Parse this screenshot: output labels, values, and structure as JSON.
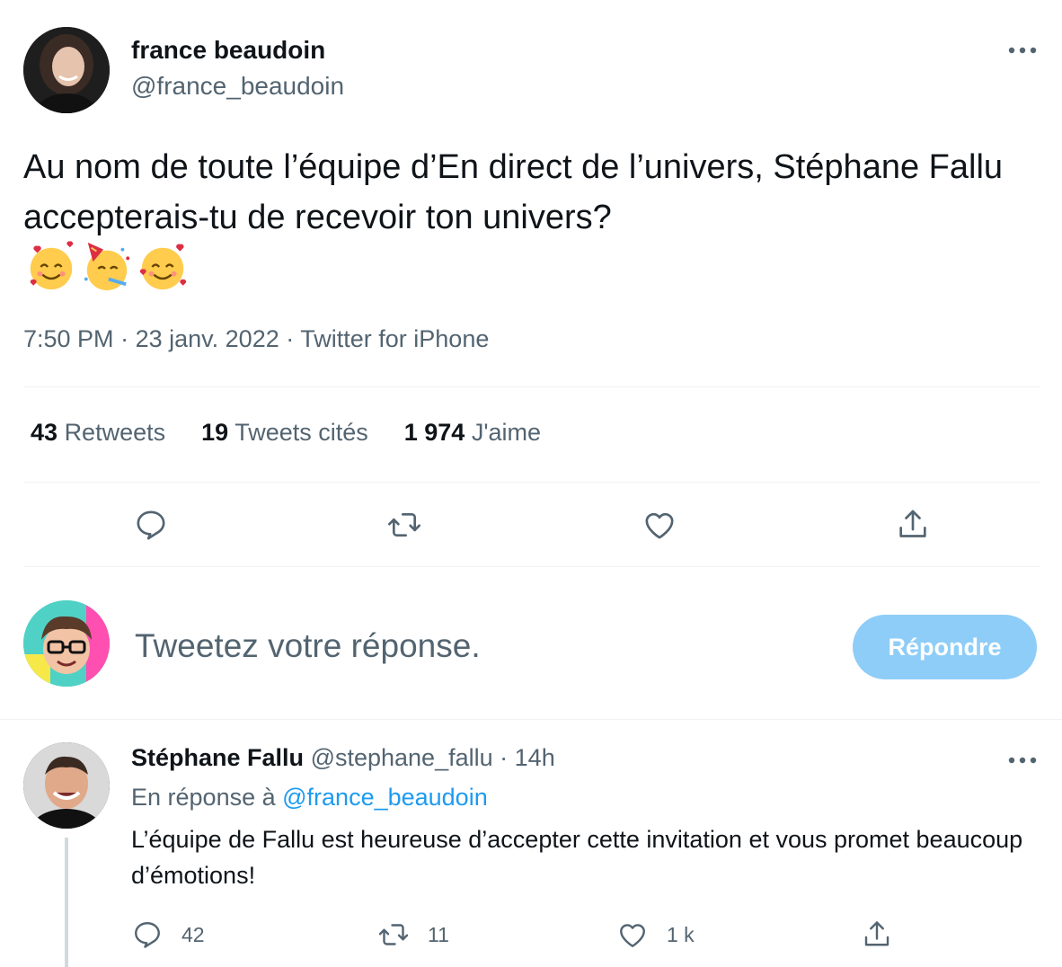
{
  "tweet": {
    "author_name": "france beaudoin",
    "author_handle": "@france_beaudoin",
    "text": "Au nom de toute l’équipe d’En direct de l’univers, Stéphane Fallu accepterais-tu de recevoir ton univers?",
    "emojis": [
      "smiling-face-with-hearts",
      "partying-face",
      "smiling-face-with-hearts"
    ],
    "time": "7:50 PM",
    "date": "23 janv. 2022",
    "source": "Twitter for iPhone",
    "separator": "·",
    "stats": {
      "retweets_count": "43",
      "retweets_label": "Retweets",
      "quotes_count": "19",
      "quotes_label": "Tweets cités",
      "likes_count": "1 974",
      "likes_label": "J'aime"
    }
  },
  "actions": [
    "reply-icon",
    "retweet-icon",
    "like-icon",
    "share-icon"
  ],
  "compose": {
    "placeholder": "Tweetez votre réponse.",
    "button_label": "Répondre"
  },
  "reply": {
    "author_name": "Stéphane Fallu",
    "author_handle": "@stephane_fallu",
    "time": "14h",
    "in_reply_prefix": "En réponse à",
    "in_reply_handle": "@france_beaudoin",
    "text": "L’équipe de Fallu est heureuse d’accepter cette invitation et vous promet beaucoup d’émotions!",
    "replies": "42",
    "retweets": "11",
    "likes": "1 k"
  },
  "colors": {
    "accent": "#1d9bf0",
    "button_disabled": "#8ecdf8",
    "muted_text": "#536471",
    "divider": "#eff3f4"
  }
}
